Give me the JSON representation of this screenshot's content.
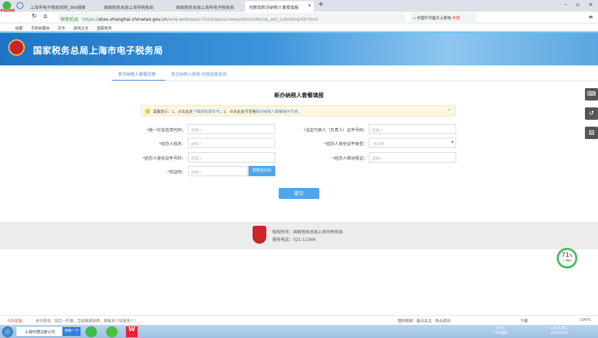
{
  "browser": {
    "tabs": [
      "上海市电子税局官网_360搜索",
      "国家税务总局上海市税务局",
      "国家税务总局上海市电子税务局",
      "创新版新办纳税人套餐填报"
    ],
    "badge": "返回首页",
    "site_tag": "税务机关",
    "url_prefix": "https://",
    "url_host": "etax.shanghai.chinatax.gov.cn",
    "url_path": "/wsq-web/wszx-front/apps/views/xbnsrzhtcsq_wrt_cxb/xbnsrDl.html",
    "search_text": "中国不可能大上很电",
    "hot_label": "热搜",
    "bookmarks": [
      "收藏",
      "手机收藏夹",
      "京东",
      "游戏大全",
      "国家税务"
    ]
  },
  "header": {
    "title": "国家税务总局上海市电子税务局"
  },
  "nav": {
    "tabs": [
      "新办纳税人套餐办理",
      "新办纳税人套餐-办税进度查询"
    ]
  },
  "page": {
    "title": "新办纳税人套餐填报",
    "tip": {
      "prefix": "温馨提示：1、点击此处",
      "link1": "下载授权委托书",
      "mid": "；2、点击此处可查看",
      "link2": "新办纳税人套餐操作手册",
      "suffix": "。",
      "close": "×"
    },
    "fields": {
      "credit_code": {
        "label": "统一社会信用代码：",
        "placeholder": "请输入"
      },
      "legal_id": {
        "label": "法定代表人（负责人）证件号码：",
        "placeholder": "请输入"
      },
      "agent_name": {
        "label": "经办人姓名：",
        "placeholder": "请输入"
      },
      "agent_id_type": {
        "label": "经办人身份证件类型：",
        "value": "-请选择-"
      },
      "agent_id": {
        "label": "经办人身份证件号码：",
        "placeholder": "请输入"
      },
      "agent_phone": {
        "label": "经办人移动电话：",
        "placeholder": "请输入"
      },
      "captcha": {
        "label": "验证码：",
        "placeholder": "请输入",
        "button": "获取验证码"
      }
    },
    "required_mark": "*",
    "submit": "提交"
  },
  "footer": {
    "copyright": "版权所有：国家税务总局上海市税务局",
    "phone": "服务电话：021-12366"
  },
  "widget": {
    "percent": "71",
    "unit": "%",
    "speed": "↑ 0K/s"
  },
  "statusbar": {
    "left": "今日优选",
    "news": "老中医说：饭后一件事，完成乘便体质，想瘦多少就瘦多少！",
    "items": [
      "我的视频",
      "每日关注",
      "热点资讯",
      "下载"
    ],
    "zoom": "100%"
  },
  "taskbar": {
    "search": "上海代理注册公司",
    "search_btn": "搜索一下",
    "temp": "36°C",
    "cpu": "CPU温度",
    "time": "14:15 周二",
    "date": "2021/11/3"
  }
}
